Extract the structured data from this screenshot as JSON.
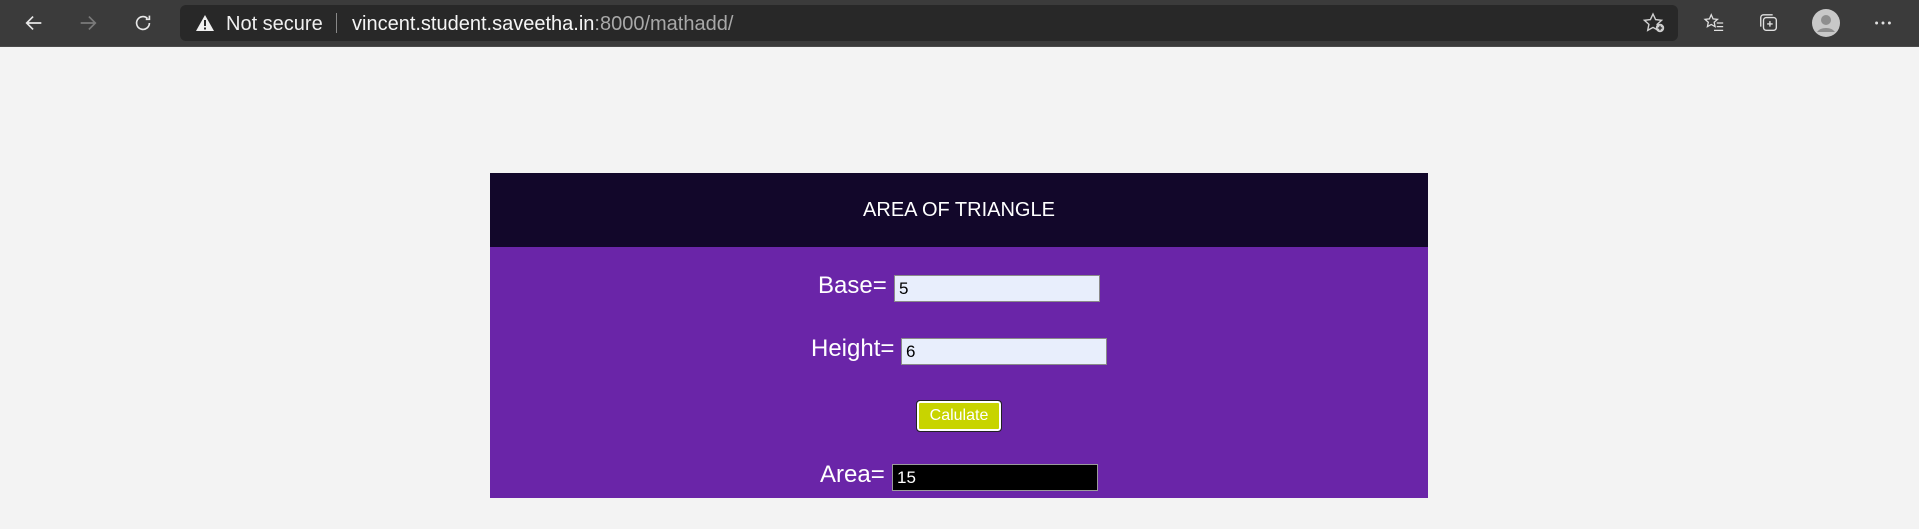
{
  "browser": {
    "security_label": "Not secure",
    "url_host": "vincent.student.saveetha.in",
    "url_rest": ":8000/mathadd/",
    "icons": {
      "back": "back-arrow-icon",
      "forward": "forward-arrow-icon",
      "refresh": "refresh-icon",
      "warning": "warning-icon",
      "add_favorite": "star-add-icon",
      "favorites": "favorites-icon",
      "collections": "collections-icon",
      "profile": "profile-icon",
      "menu": "more-icon"
    }
  },
  "page": {
    "title": "AREA OF TRIANGLE",
    "base_label": "Base=",
    "base_value": "5",
    "height_label": "Height=",
    "height_value": "6",
    "button_label": "Calulate",
    "area_label": "Area=",
    "area_value": "15",
    "colors": {
      "header_bg": "#12072a",
      "body_bg": "#6a25a8",
      "button_bg": "#c8d400",
      "result_bg": "#000000"
    }
  }
}
